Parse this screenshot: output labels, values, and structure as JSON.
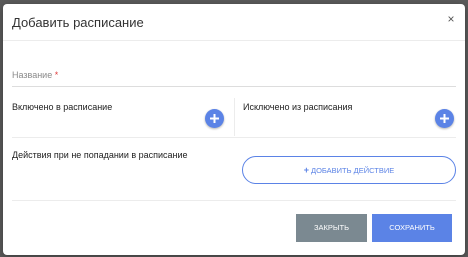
{
  "dialog": {
    "title": "Добавить расписание",
    "close_symbol": "×"
  },
  "form": {
    "name_label": "Название",
    "name_required_mark": "*",
    "name_value": "",
    "included_label": "Включено в расписание",
    "excluded_label": "Исключено из расписания",
    "actions_label": "Действия при не попадании в расписание",
    "add_action_plus": "+",
    "add_action_label": "ДОБАВИТЬ ДЕЙСТВИЕ"
  },
  "footer": {
    "close_label": "ЗАКРЫТЬ",
    "save_label": "СОХРАНИТЬ"
  },
  "colors": {
    "accent": "#5b83e6",
    "secondary_button": "#7b8991",
    "required": "#e04040"
  }
}
